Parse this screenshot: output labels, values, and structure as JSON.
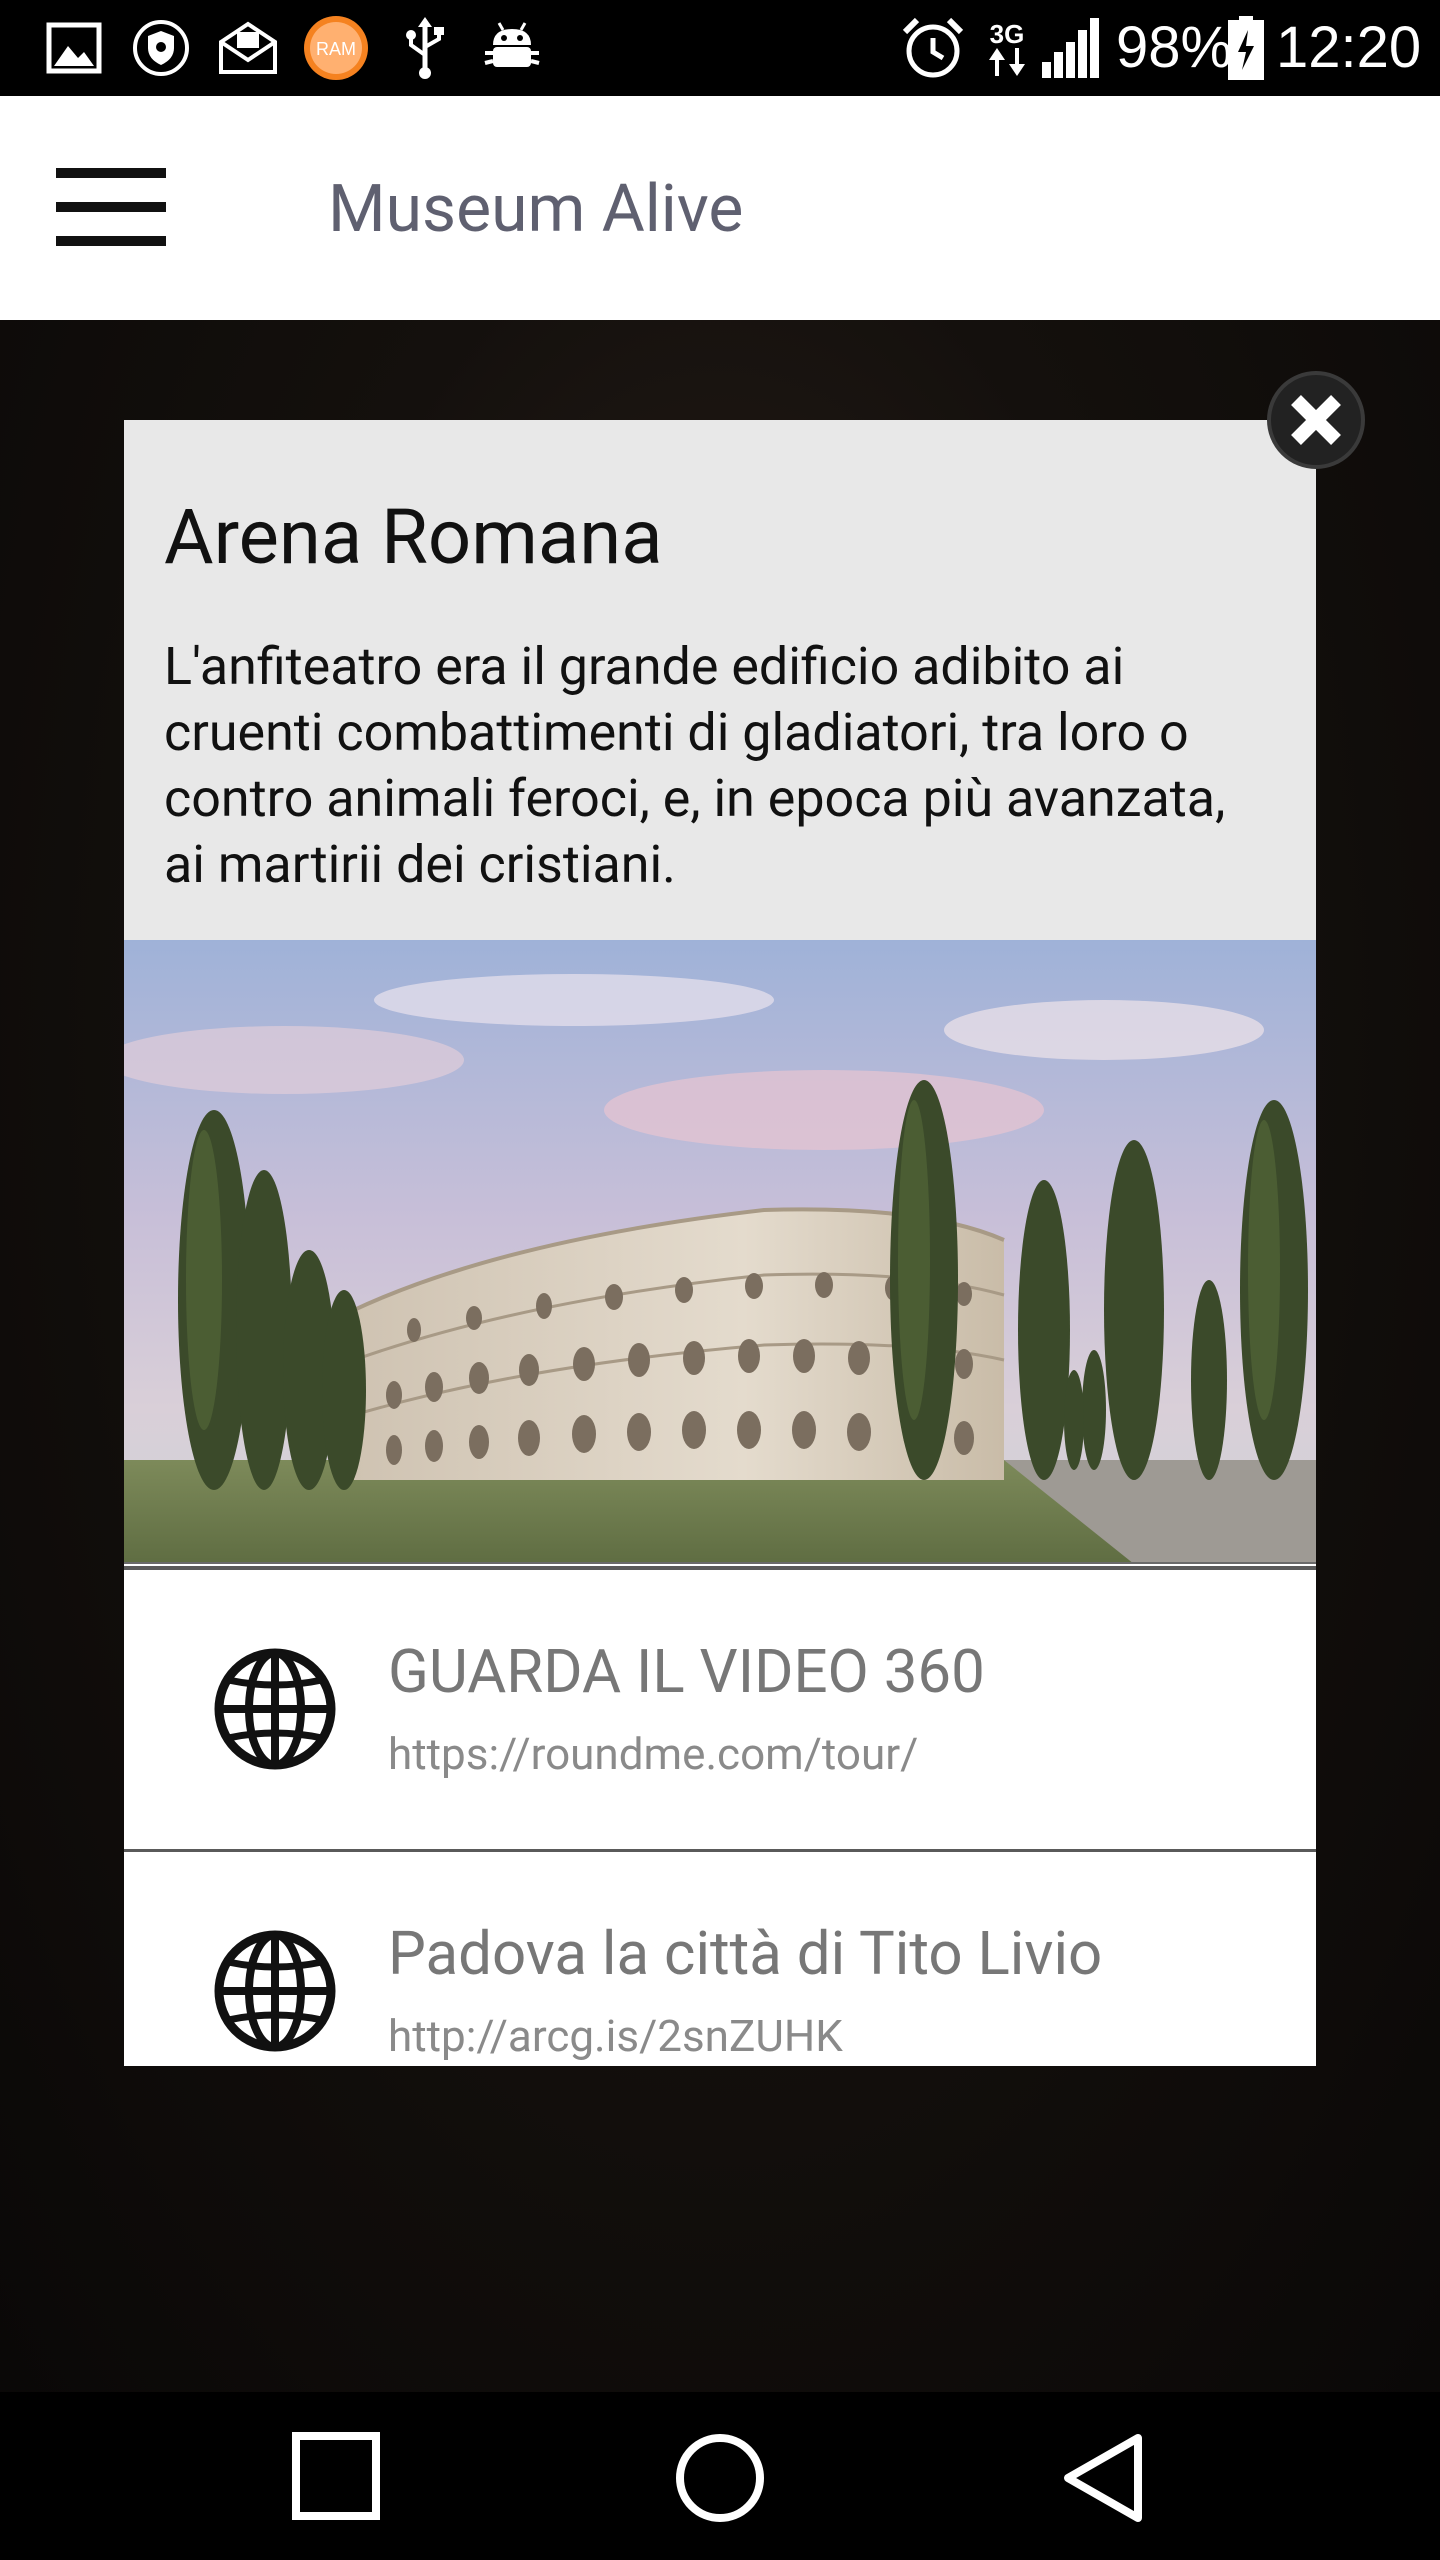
{
  "status_bar": {
    "battery_percent": "98%",
    "time": "12:20",
    "network": "3G",
    "ram_label": "RAM",
    "icons": [
      "gallery-icon",
      "shield-icon",
      "mail-sync-icon",
      "ram-booster-icon",
      "usb-icon",
      "android-debug-icon",
      "alarm-icon",
      "network-3g-icon",
      "signal-icon",
      "battery-charging-icon"
    ]
  },
  "app_bar": {
    "title": "Museum Alive",
    "menu_icon": "hamburger-menu-icon"
  },
  "dialog": {
    "title": "Arena Romana",
    "description": "L'anfiteatro era il grande edificio adibito ai cruenti combattimenti di gladiatori, tra loro o contro animali feroci, e, in epoca più avanzata, ai martirii dei cristiani.",
    "close_icon": "close-icon",
    "image_subject": "arena-romana-reconstruction",
    "links": [
      {
        "title": "GUARDA IL VIDEO 360",
        "url": "https://roundme.com/tour/",
        "icon": "globe-icon"
      },
      {
        "title": "Padova la città di Tito Livio",
        "url": "http://arcg.is/2snZUHK",
        "icon": "globe-icon"
      }
    ]
  },
  "nav_bar": {
    "buttons": [
      "recents-square-icon",
      "home-circle-icon",
      "back-triangle-icon"
    ]
  },
  "colors": {
    "status_bar_bg": "#000000",
    "app_bar_bg": "#ffffff",
    "title_text": "#5f6070",
    "dialog_header_bg": "#e8e8e8",
    "link_text": "#777777"
  }
}
